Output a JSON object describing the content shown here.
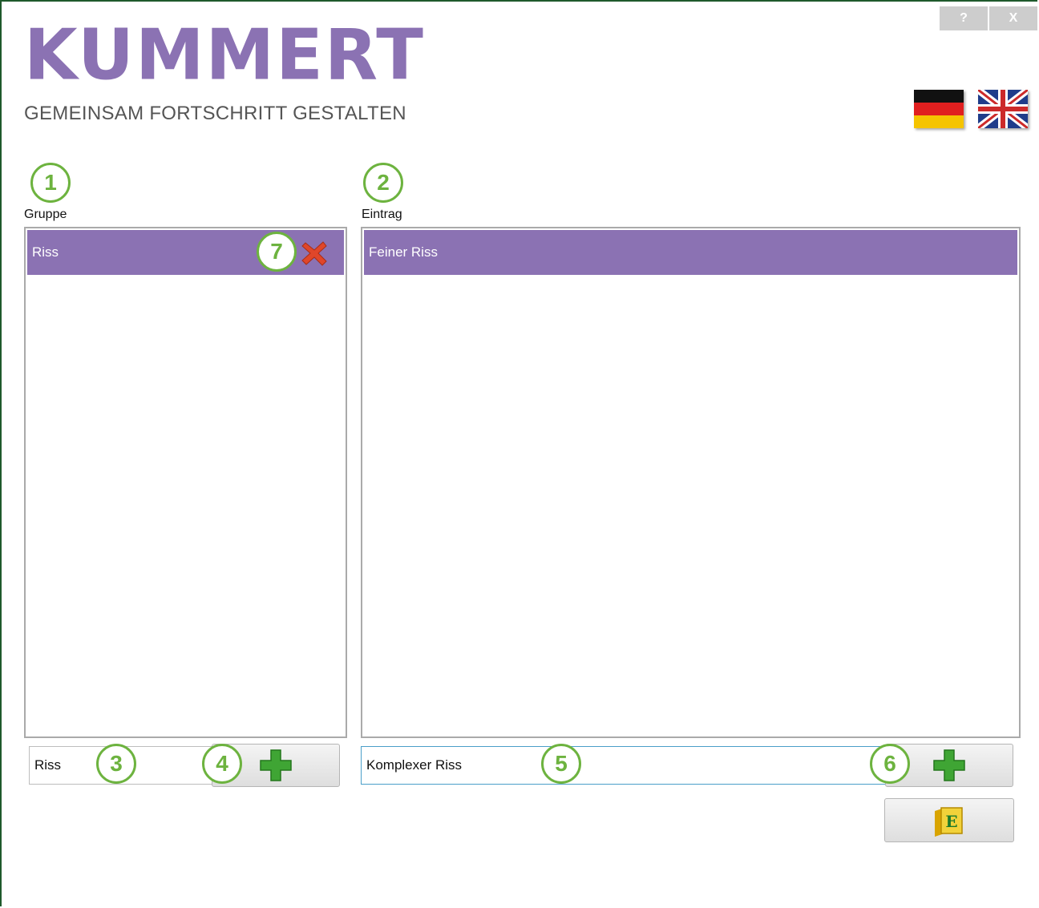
{
  "titlebar": {
    "help_label": "?",
    "close_label": "X"
  },
  "logo": {
    "wordmark": "KUMMERT",
    "tagline": "GEMEINSAM FORTSCHRITT GESTALTEN"
  },
  "languages": [
    {
      "name": "flag-de-icon"
    },
    {
      "name": "flag-uk-icon"
    }
  ],
  "callouts": [
    "1",
    "2",
    "3",
    "4",
    "5",
    "6",
    "7"
  ],
  "group_panel": {
    "label": "Gruppe",
    "items": [
      {
        "label": "Riss"
      }
    ],
    "input_value": "Riss"
  },
  "entry_panel": {
    "label": "Eintrag",
    "items": [
      {
        "label": "Feiner Riss"
      }
    ],
    "input_value": "Komplexer Riss"
  },
  "colors": {
    "accent": "#8b72b3",
    "callout": "#6db33f",
    "add_icon": "#3fa534",
    "delete_icon": "#e0462a",
    "export_icon": "#e6c21a"
  },
  "icons": {
    "delete": "delete-x-icon",
    "add": "plus-icon",
    "export": "excel-folder-icon",
    "export_letter": "E"
  }
}
